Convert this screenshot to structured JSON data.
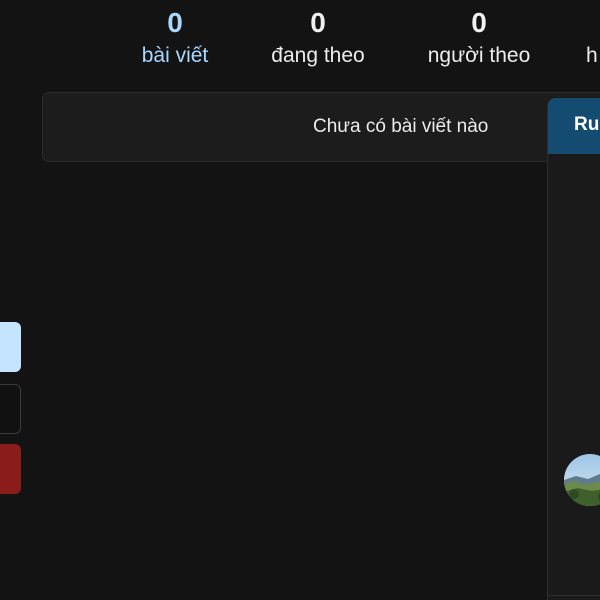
{
  "stats": [
    {
      "value": "0",
      "label": "bài viết"
    },
    {
      "value": "0",
      "label": "đang theo"
    },
    {
      "value": "0",
      "label": "người theo"
    },
    {
      "label_partial": "h"
    }
  ],
  "feed": {
    "empty_message": "Chưa có bài viết nào"
  },
  "right_panel": {
    "title_partial": "Ru",
    "avatar_icon": "landscape-avatar-icon"
  },
  "colors": {
    "background": "#131313",
    "active_stat": "#a8d8ff",
    "panel_header": "#144b70",
    "primary_button": "#c4e4ff",
    "danger_button": "#8a1c1c"
  }
}
